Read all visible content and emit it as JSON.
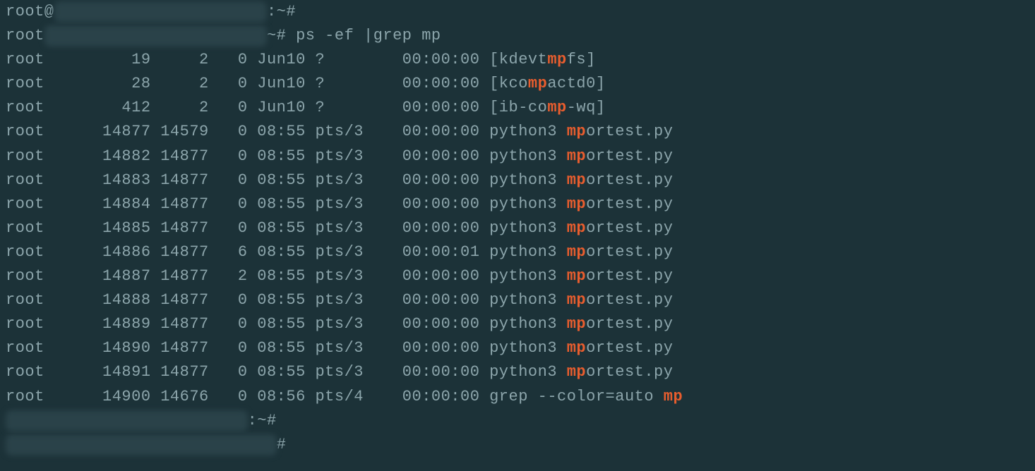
{
  "prompt1": {
    "prefix": "root@",
    "hidden": "xxxxxxxxxxxxxxxxxxxxxx",
    "suffix": ":~#"
  },
  "prompt2": {
    "prefix": "root",
    "hidden": "xxxxxxxxxxxxxxxxxxxxxxx",
    "suffix": "~# ",
    "command": "ps -ef |grep mp"
  },
  "rows": [
    {
      "uid": "root",
      "pid": "19",
      "ppid": "2",
      "c": "0",
      "stime": "Jun10",
      "tty": "?",
      "time": "00:00:00",
      "cmd_pre": "[kdevt",
      "cmd_hl": "mp",
      "cmd_post": "fs]"
    },
    {
      "uid": "root",
      "pid": "28",
      "ppid": "2",
      "c": "0",
      "stime": "Jun10",
      "tty": "?",
      "time": "00:00:00",
      "cmd_pre": "[kco",
      "cmd_hl": "mp",
      "cmd_post": "actd0]"
    },
    {
      "uid": "root",
      "pid": "412",
      "ppid": "2",
      "c": "0",
      "stime": "Jun10",
      "tty": "?",
      "time": "00:00:00",
      "cmd_pre": "[ib-co",
      "cmd_hl": "mp",
      "cmd_post": "-wq]"
    },
    {
      "uid": "root",
      "pid": "14877",
      "ppid": "14579",
      "c": "0",
      "stime": "08:55",
      "tty": "pts/3",
      "time": "00:00:00",
      "cmd_pre": "python3 ",
      "cmd_hl": "mp",
      "cmd_post": "ortest.py"
    },
    {
      "uid": "root",
      "pid": "14882",
      "ppid": "14877",
      "c": "0",
      "stime": "08:55",
      "tty": "pts/3",
      "time": "00:00:00",
      "cmd_pre": "python3 ",
      "cmd_hl": "mp",
      "cmd_post": "ortest.py"
    },
    {
      "uid": "root",
      "pid": "14883",
      "ppid": "14877",
      "c": "0",
      "stime": "08:55",
      "tty": "pts/3",
      "time": "00:00:00",
      "cmd_pre": "python3 ",
      "cmd_hl": "mp",
      "cmd_post": "ortest.py"
    },
    {
      "uid": "root",
      "pid": "14884",
      "ppid": "14877",
      "c": "0",
      "stime": "08:55",
      "tty": "pts/3",
      "time": "00:00:00",
      "cmd_pre": "python3 ",
      "cmd_hl": "mp",
      "cmd_post": "ortest.py"
    },
    {
      "uid": "root",
      "pid": "14885",
      "ppid": "14877",
      "c": "0",
      "stime": "08:55",
      "tty": "pts/3",
      "time": "00:00:00",
      "cmd_pre": "python3 ",
      "cmd_hl": "mp",
      "cmd_post": "ortest.py"
    },
    {
      "uid": "root",
      "pid": "14886",
      "ppid": "14877",
      "c": "6",
      "stime": "08:55",
      "tty": "pts/3",
      "time": "00:00:01",
      "cmd_pre": "python3 ",
      "cmd_hl": "mp",
      "cmd_post": "ortest.py"
    },
    {
      "uid": "root",
      "pid": "14887",
      "ppid": "14877",
      "c": "2",
      "stime": "08:55",
      "tty": "pts/3",
      "time": "00:00:00",
      "cmd_pre": "python3 ",
      "cmd_hl": "mp",
      "cmd_post": "ortest.py"
    },
    {
      "uid": "root",
      "pid": "14888",
      "ppid": "14877",
      "c": "0",
      "stime": "08:55",
      "tty": "pts/3",
      "time": "00:00:00",
      "cmd_pre": "python3 ",
      "cmd_hl": "mp",
      "cmd_post": "ortest.py"
    },
    {
      "uid": "root",
      "pid": "14889",
      "ppid": "14877",
      "c": "0",
      "stime": "08:55",
      "tty": "pts/3",
      "time": "00:00:00",
      "cmd_pre": "python3 ",
      "cmd_hl": "mp",
      "cmd_post": "ortest.py"
    },
    {
      "uid": "root",
      "pid": "14890",
      "ppid": "14877",
      "c": "0",
      "stime": "08:55",
      "tty": "pts/3",
      "time": "00:00:00",
      "cmd_pre": "python3 ",
      "cmd_hl": "mp",
      "cmd_post": "ortest.py"
    },
    {
      "uid": "root",
      "pid": "14891",
      "ppid": "14877",
      "c": "0",
      "stime": "08:55",
      "tty": "pts/3",
      "time": "00:00:00",
      "cmd_pre": "python3 ",
      "cmd_hl": "mp",
      "cmd_post": "ortest.py"
    },
    {
      "uid": "root",
      "pid": "14900",
      "ppid": "14676",
      "c": "0",
      "stime": "08:56",
      "tty": "pts/4",
      "time": "00:00:00",
      "cmd_pre": "grep --color=auto ",
      "cmd_hl": "mp",
      "cmd_post": ""
    }
  ],
  "prompt3": {
    "hidden": "xxxxxxxxxxxxxxxxxxxxxxxxx",
    "suffix": ":~#"
  },
  "prompt4": {
    "hidden": "xxxxxxxxxxxxxxxxxxxxxxxxxxxx",
    "suffix": "#"
  }
}
